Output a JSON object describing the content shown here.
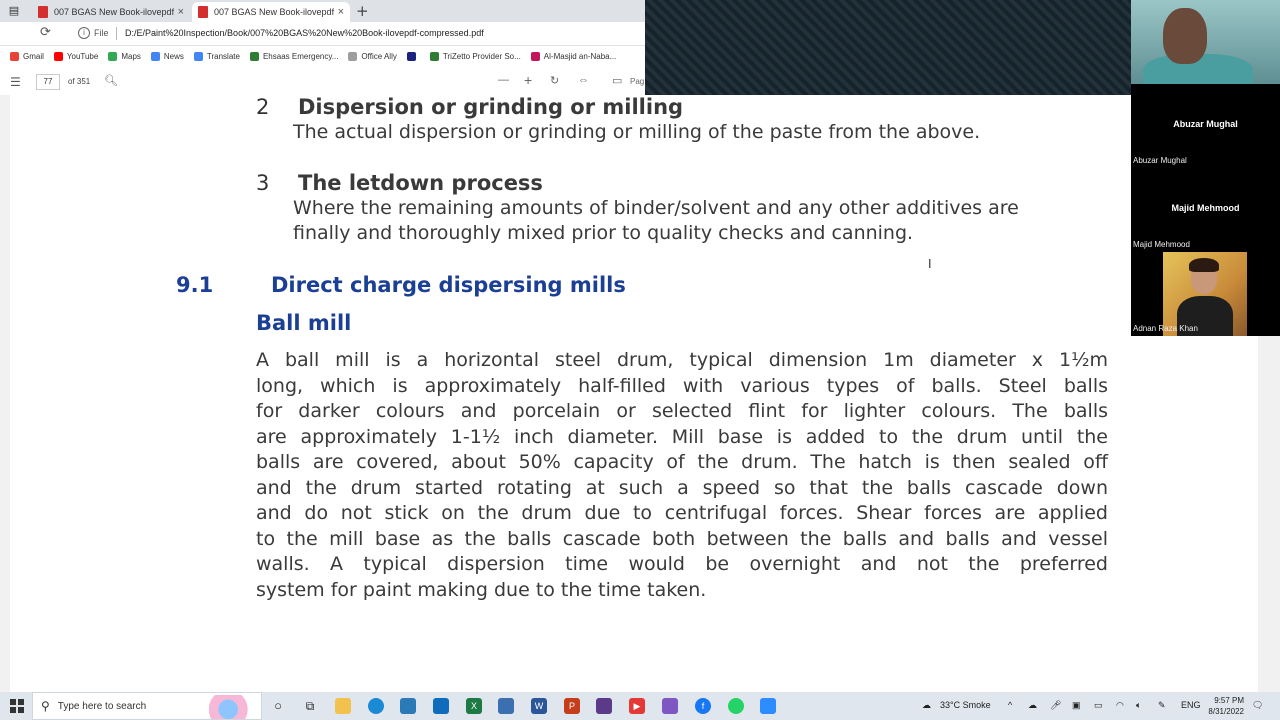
{
  "browser": {
    "tabs": [
      {
        "label": "007 BGAS New Book-ilovepdf-co",
        "close": "×"
      },
      {
        "label": "007 BGAS New Book-ilovepdf-co",
        "close": "×"
      }
    ],
    "new_tab": "+",
    "address": {
      "scheme_label": "File",
      "url": "D:/E/Paint%20Inspection/Book/007%20BGAS%20New%20Book-ilovepdf-compressed.pdf"
    },
    "bookmarks": [
      {
        "label": "Gmail",
        "color": "#ea4335"
      },
      {
        "label": "YouTube",
        "color": "#ff0000"
      },
      {
        "label": "Maps",
        "color": "#34a853"
      },
      {
        "label": "News",
        "color": "#4285f4"
      },
      {
        "label": "Translate",
        "color": "#4285f4"
      },
      {
        "label": "Ehsaas Emergency...",
        "color": "#2e7d32"
      },
      {
        "label": "Office Ally",
        "color": "#9e9e9e"
      },
      {
        "label": "",
        "color": "#1a237e"
      },
      {
        "label": "TriZetto Provider So...",
        "color": "#2e7d32"
      },
      {
        "label": "Al-Masjid an-Naba...",
        "color": "#c2185b"
      }
    ]
  },
  "pdf_toolbar": {
    "page_number": "77",
    "page_total": "of 351",
    "page_view_label": "Pag"
  },
  "document": {
    "sections": [
      {
        "number": "2",
        "title": "Dispersion or grinding or milling",
        "lines": [
          "The actual dispersion or grinding or milling of the paste from the above."
        ]
      },
      {
        "number": "3",
        "title": "The letdown process",
        "lines": [
          "Where the remaining amounts of binder/solvent and any other additives are",
          "finally and thoroughly mixed prior to quality checks and canning."
        ]
      }
    ],
    "chapter": {
      "number": "9.1",
      "title": "Direct charge dispersing mills"
    },
    "subheading": "Ball mill",
    "body_lines": [
      "A ball mill is a horizontal steel drum, typical dimension 1m diameter x 1½m",
      "long, which is approximately half-filled with various types of balls. Steel balls",
      "for darker colours and porcelain or selected flint for lighter colours. The balls",
      "are approximately 1-1½ inch diameter. Mill base is added to the drum until the",
      "balls are covered, about 50% capacity of the drum. The hatch is then sealed off",
      "and the drum started rotating at such a speed so that the balls cascade down",
      "and do not stick on the drum due to centrifugal forces. Shear forces are applied",
      "to the mill base as the balls cascade both between the balls and balls and vessel",
      "walls. A typical dispersion time would be overnight and not the preferred",
      "system for paint making due to the time taken."
    ]
  },
  "meeting": {
    "participants": [
      {
        "display_name": "Abuzar Mughal",
        "label": "Abuzar Mughal"
      },
      {
        "display_name": "Majid Mehmood",
        "label": "Majid Mehmood"
      },
      {
        "label": "Adnan Raza Khan"
      }
    ]
  },
  "taskbar": {
    "search_placeholder": "Type here to search",
    "weather": "33°C  Smoke",
    "language": "ENG",
    "time": "9:57 PM",
    "date": "8/31/2022"
  },
  "colors": {
    "heading_blue": "#1b3f94",
    "body_text": "#3a3a3a",
    "pdf_red": "#d32f2f"
  }
}
